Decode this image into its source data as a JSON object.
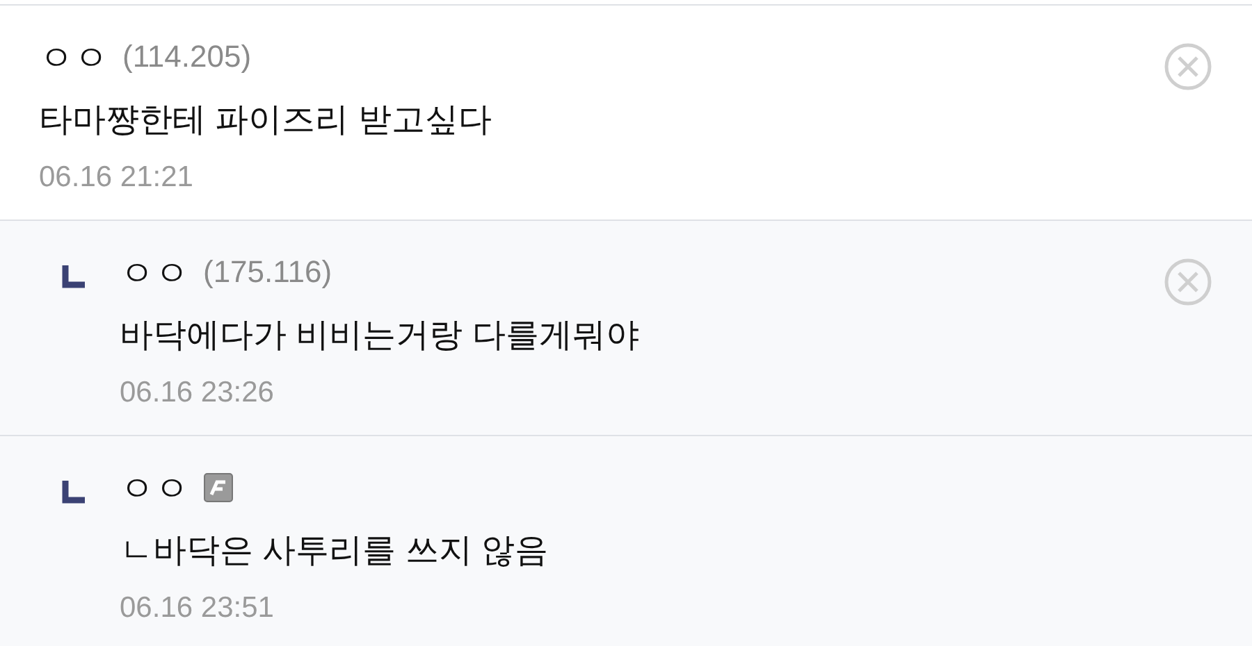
{
  "comments": [
    {
      "kind": "comment",
      "nickname": "ㅇㅇ",
      "ip": "(114.205)",
      "fixed_nick": false,
      "body": "타마쨩한테 파이즈리 받고싶다",
      "date": "06.16 21:21",
      "deletable": true
    },
    {
      "kind": "reply",
      "nickname": "ㅇㅇ",
      "ip": "(175.116)",
      "fixed_nick": false,
      "body": "바닥에다가 비비는거랑 다를게뭐야",
      "date": "06.16 23:26",
      "deletable": true
    },
    {
      "kind": "reply",
      "nickname": "ㅇㅇ",
      "fixed_nick": true,
      "body": "ㄴ바닥은 사투리를 쓰지 않음",
      "date": "06.16 23:51",
      "deletable": false
    }
  ]
}
